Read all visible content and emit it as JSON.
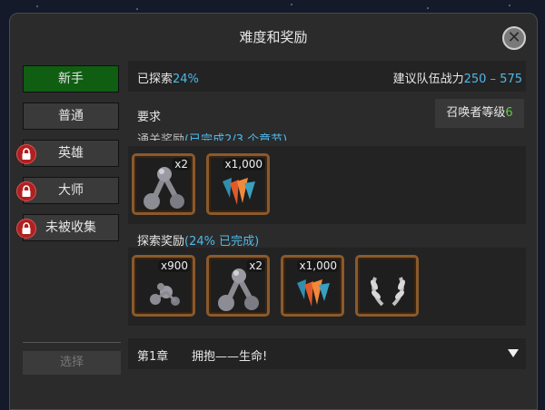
{
  "title": "难度和奖励",
  "difficulties": [
    {
      "label": "新手",
      "active": true,
      "locked": false
    },
    {
      "label": "普通",
      "active": false,
      "locked": false
    },
    {
      "label": "英雄",
      "active": false,
      "locked": true
    },
    {
      "label": "大师",
      "active": false,
      "locked": true
    },
    {
      "label": "未被收集",
      "active": false,
      "locked": true
    }
  ],
  "select_label": "选择",
  "explored": {
    "label": "已探索",
    "value": "24%"
  },
  "recommended_power": {
    "label": "建议队伍战力",
    "min": "250",
    "separator": " – ",
    "max": "575"
  },
  "requirement": {
    "label": "要求",
    "summoner_label": "召唤者等级",
    "summoner_value": "6"
  },
  "clear_rewards": {
    "label_partial": "通关奖励",
    "status_partial": "(已完成2/3 个章节)",
    "items": [
      {
        "icon": "catalyst-icon",
        "count": "x2"
      },
      {
        "icon": "crystal-shards-icon",
        "count": "x1,000"
      }
    ]
  },
  "explore_rewards": {
    "label": "探索奖励",
    "percent": "24%",
    "status_suffix": " 已完成",
    "items": [
      {
        "icon": "catalyst-fragments-icon",
        "count": "x900"
      },
      {
        "icon": "catalyst-icon",
        "count": "x2"
      },
      {
        "icon": "crystal-shards-icon",
        "count": "x1,000"
      },
      {
        "icon": "laurel-wreath-icon",
        "count": ""
      }
    ]
  },
  "chapter": {
    "number": "第1章",
    "name": "拥抱——生命!"
  },
  "colors": {
    "accent_blue": "#4fb8e8",
    "accent_green": "#5ccc3c",
    "active_green": "#0f5e12",
    "frame_bronze": "#8a5a2c",
    "lock_red": "#b02020"
  }
}
